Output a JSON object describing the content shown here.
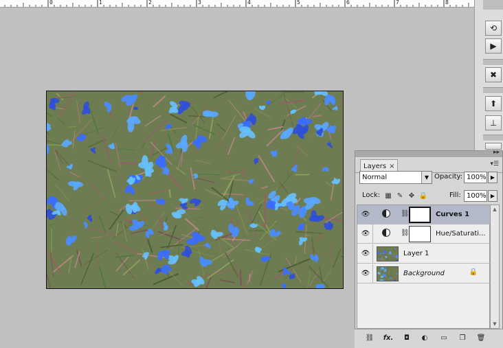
{
  "ruler": {
    "labels": [
      "0",
      "1",
      "2",
      "3",
      "4",
      "5",
      "6",
      "7",
      "8"
    ]
  },
  "dock": {
    "icons": [
      "history-icon",
      "actions-icon",
      "tools-icon",
      "clone-source-icon",
      "stamp-icon",
      "brush-presets-icon"
    ]
  },
  "panel": {
    "tab_label": "Layers",
    "tab_close": "×",
    "collapse_glyph": "▸▸",
    "menu_glyph": "▾☰",
    "blend_mode": "Normal",
    "opacity_label": "Opacity:",
    "opacity_value": "100%",
    "lock_label": "Lock:",
    "fill_label": "Fill:",
    "fill_value": "100%",
    "layers": [
      {
        "name": "Curves 1",
        "type": "adjustment",
        "selected": true,
        "visible": true
      },
      {
        "name": "Hue/Saturati...",
        "type": "adjustment",
        "selected": false,
        "visible": true
      },
      {
        "name": "Layer 1",
        "type": "pixel",
        "selected": false,
        "visible": true
      },
      {
        "name": "Background",
        "type": "background",
        "selected": false,
        "visible": true,
        "locked": true
      }
    ],
    "footer_buttons": [
      "link-layers-icon",
      "fx-icon",
      "add-mask-icon",
      "new-adjustment-icon",
      "new-group-icon",
      "new-layer-icon",
      "delete-layer-icon"
    ],
    "footer_fx_text": "fx."
  },
  "colors": {
    "workspace": "#c0c0c0",
    "panel_bg": "#d6d6d6",
    "selected_row": "#b3b9c9",
    "flower_blue": "#4a8cff"
  }
}
